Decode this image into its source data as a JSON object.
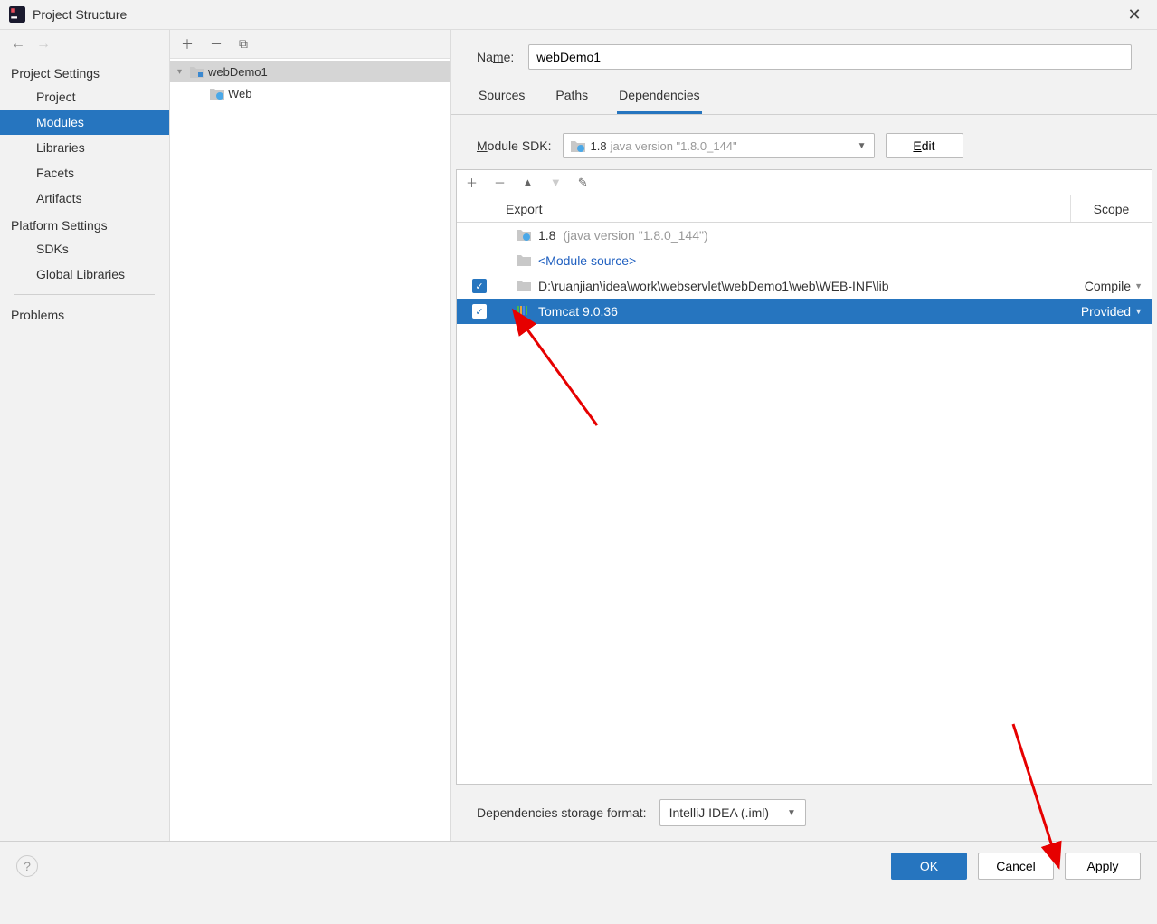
{
  "window": {
    "title": "Project Structure"
  },
  "leftnav": {
    "section1": "Project Settings",
    "project": "Project",
    "modules": "Modules",
    "libraries": "Libraries",
    "facets": "Facets",
    "artifacts": "Artifacts",
    "section2": "Platform Settings",
    "sdks": "SDKs",
    "globallibs": "Global Libraries",
    "problems": "Problems"
  },
  "tree": {
    "root": "webDemo1",
    "child": "Web"
  },
  "name_label_pre": "Na",
  "name_label_ul": "m",
  "name_label_post": "e:",
  "name_value": "webDemo1",
  "tabs": {
    "sources": "Sources",
    "paths": "Paths",
    "deps": "Dependencies"
  },
  "sdk_label_ul": "M",
  "sdk_label_post": "odule SDK:",
  "sdk_main": "1.8",
  "sdk_sub": "java version \"1.8.0_144\"",
  "edit_ul": "E",
  "edit_post": "dit",
  "dep_header_export": "Export",
  "dep_header_scope": "Scope",
  "deps": [
    {
      "main": "1.8",
      "sub": "(java version \"1.8.0_144\")",
      "export": false,
      "icon": "java",
      "scope": "",
      "link": false
    },
    {
      "main": "<Module source>",
      "sub": "",
      "export": false,
      "icon": "folder",
      "scope": "",
      "link": true
    },
    {
      "main": "D:\\ruanjian\\idea\\work\\webservlet\\webDemo1\\web\\WEB-INF\\lib",
      "sub": "",
      "export": true,
      "icon": "folder",
      "scope": "Compile",
      "link": false
    },
    {
      "main": "Tomcat 9.0.36",
      "sub": "",
      "export": true,
      "icon": "lib",
      "scope": "Provided",
      "link": false,
      "selected": true
    }
  ],
  "storage_label": "Dependencies storage format:",
  "storage_value": "IntelliJ IDEA (.iml)",
  "buttons": {
    "ok": "OK",
    "cancel": "Cancel",
    "apply_ul": "A",
    "apply_post": "pply"
  },
  "colors": {
    "accent": "#2675bf"
  }
}
